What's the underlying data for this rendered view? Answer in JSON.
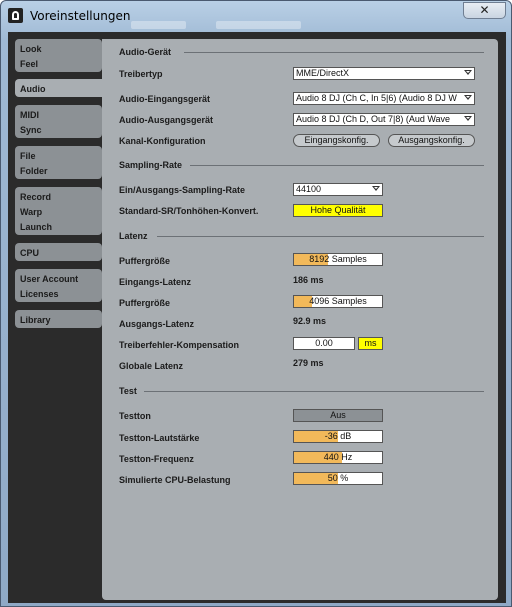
{
  "window": {
    "title": "Voreinstellungen",
    "close_glyph": "✕"
  },
  "tabs": [
    {
      "lines": [
        "Look",
        "Feel"
      ]
    },
    {
      "lines": [
        "Audio"
      ]
    },
    {
      "lines": [
        "MIDI",
        "Sync"
      ]
    },
    {
      "lines": [
        "File",
        "Folder"
      ]
    },
    {
      "lines": [
        "Record",
        "Warp",
        "Launch"
      ]
    },
    {
      "lines": [
        "CPU"
      ]
    },
    {
      "lines": [
        "User Account",
        "Licenses"
      ]
    },
    {
      "lines": [
        "Library"
      ]
    }
  ],
  "active_tab": "Audio",
  "audio_device": {
    "heading": "Audio-Gerät",
    "driver_type_label": "Treibertyp",
    "driver_type_value": "MME/DirectX",
    "input_device_label": "Audio-Eingangsgerät",
    "input_device_value": "Audio 8 DJ (Ch C, In 5|6) (Audio 8 DJ W",
    "output_device_label": "Audio-Ausgangsgerät",
    "output_device_value": "Audio 8 DJ (Ch D, Out 7|8) (Aud Wave",
    "channel_config_label": "Kanal-Konfiguration",
    "input_config_button": "Eingangskonfig.",
    "output_config_button": "Ausgangskonfig."
  },
  "sampling_rate": {
    "heading": "Sampling-Rate",
    "io_rate_label": "Ein/Ausgangs-Sampling-Rate",
    "io_rate_value": "44100",
    "default_conv_label": "Standard-SR/Tonhöhen-Konvert.",
    "default_conv_value": "Hohe Qualität"
  },
  "latency": {
    "heading": "Latenz",
    "buffer_size_label": "Puffergröße",
    "buffer_size_in_value": "8192 Samples",
    "buffer_size_in_fill": 0.39,
    "input_latency_label": "Eingangs-Latenz",
    "input_latency_value": "186 ms",
    "buffer_size_out_label": "Puffergröße",
    "buffer_size_out_value": "4096 Samples",
    "buffer_size_out_fill": 0.21,
    "output_latency_label": "Ausgangs-Latenz",
    "output_latency_value": "92.9 ms",
    "driver_comp_label": "Treiberfehler-Kompensation",
    "driver_comp_value": "0.00",
    "driver_comp_unit": "ms",
    "overall_latency_label": "Globale Latenz",
    "overall_latency_value": "279 ms"
  },
  "test": {
    "heading": "Test",
    "tone_label": "Testton",
    "tone_value": "Aus",
    "volume_label": "Testton-Lautstärke",
    "volume_value": "-36 dB",
    "volume_fill": 0.5,
    "frequency_label": "Testton-Frequenz",
    "frequency_value": "440 Hz",
    "frequency_fill": 0.55,
    "cpu_label": "Simulierte CPU-Belastung",
    "cpu_value": "50 %",
    "cpu_fill": 0.5
  },
  "colors": {
    "panel": "#a9aeb2",
    "tab": "#8c9195",
    "background": "#2b2b2b",
    "fill": "#f2b95a",
    "highlight": "#ffff00"
  }
}
